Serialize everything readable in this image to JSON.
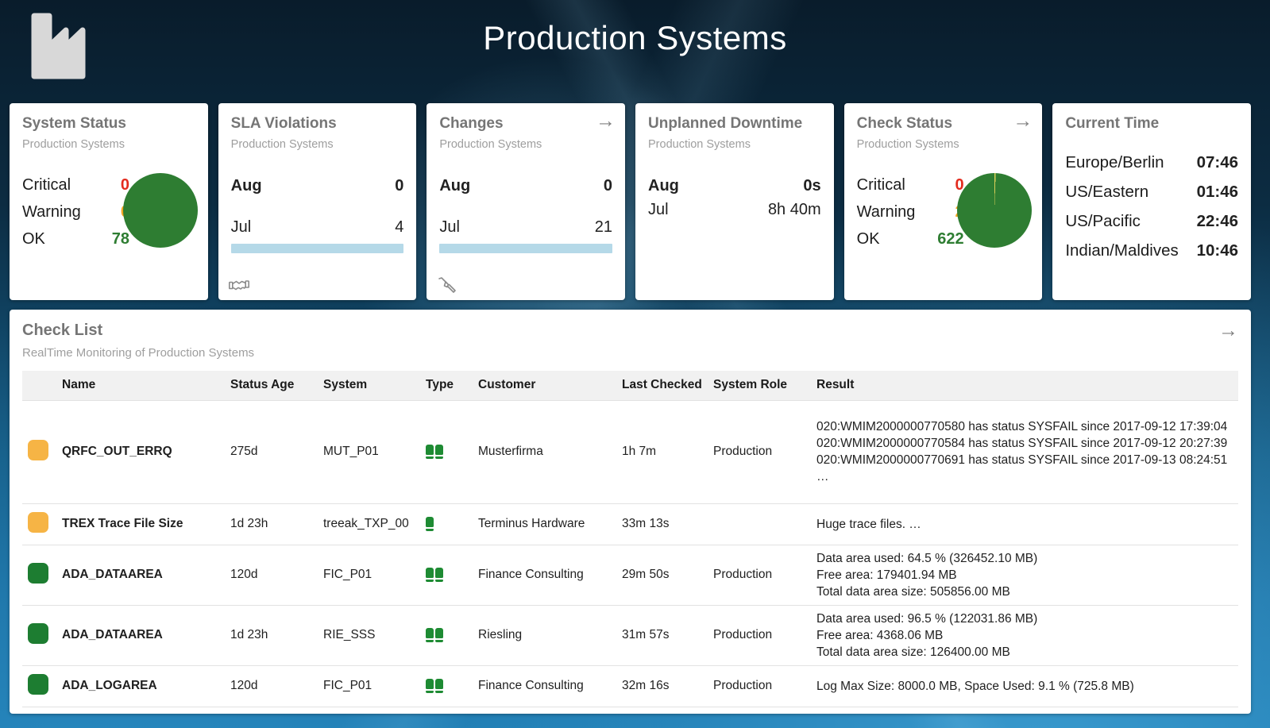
{
  "header": {
    "title": "Production Systems"
  },
  "colors": {
    "critical": "#e32b1e",
    "warning": "#f5a623",
    "ok": "#2e7d32",
    "bar": "#b5d9e8"
  },
  "cards": {
    "system_status": {
      "title": "System Status",
      "subtitle": "Production Systems",
      "rows": [
        {
          "label": "Critical",
          "value": "0"
        },
        {
          "label": "Warning",
          "value": "0"
        },
        {
          "label": "OK",
          "value": "78"
        }
      ]
    },
    "sla_violations": {
      "title": "SLA Violations",
      "subtitle": "Production Systems",
      "rows": [
        {
          "label": "Aug",
          "value": "0"
        },
        {
          "label": "Jul",
          "value": "4"
        }
      ]
    },
    "changes": {
      "title": "Changes",
      "subtitle": "Production Systems",
      "arrow": "→",
      "rows": [
        {
          "label": "Aug",
          "value": "0"
        },
        {
          "label": "Jul",
          "value": "21"
        }
      ]
    },
    "unplanned_downtime": {
      "title": "Unplanned Downtime",
      "subtitle": "Production Systems",
      "rows": [
        {
          "label": "Aug",
          "value": "0s"
        },
        {
          "label": "Jul",
          "value": "8h 40m"
        }
      ]
    },
    "check_status": {
      "title": "Check Status",
      "subtitle": "Production Systems",
      "arrow": "→",
      "rows": [
        {
          "label": "Critical",
          "value": "0"
        },
        {
          "label": "Warning",
          "value": "2"
        },
        {
          "label": "OK",
          "value": "622"
        }
      ]
    },
    "current_time": {
      "title": "Current Time",
      "rows": [
        {
          "label": "Europe/Berlin",
          "value": "07:46"
        },
        {
          "label": "US/Eastern",
          "value": "01:46"
        },
        {
          "label": "US/Pacific",
          "value": "22:46"
        },
        {
          "label": "Indian/Maldives",
          "value": "10:46"
        }
      ]
    }
  },
  "checklist": {
    "title": "Check List",
    "subtitle": "RealTime Monitoring of Production Systems",
    "arrow": "→",
    "columns": {
      "name": "Name",
      "status_age": "Status Age",
      "system": "System",
      "type": "Type",
      "customer": "Customer",
      "last_checked": "Last Checked",
      "system_role": "System Role",
      "result": "Result"
    },
    "rows": [
      {
        "status": "warning",
        "name": "QRFC_OUT_ERRQ",
        "status_age": "275d",
        "system": "MUT_P01",
        "type": "double-db",
        "customer": "Musterfirma",
        "last_checked": "1h 7m",
        "system_role": "Production",
        "result": "020:WMIM2000000770580 has status SYSFAIL since 2017-09-12 17:39:04\n020:WMIM2000000770584 has status SYSFAIL since 2017-09-12 20:27:39\n020:WMIM2000000770691 has status SYSFAIL since 2017-09-13 08:24:51 …"
      },
      {
        "status": "warning",
        "name": "TREX Trace File Size",
        "status_age": "1d 23h",
        "system": "treeak_TXP_00",
        "type": "single-db",
        "customer": "Terminus Hardware",
        "last_checked": "33m 13s",
        "system_role": "",
        "result": "Huge trace files. …"
      },
      {
        "status": "ok",
        "name": "ADA_DATAAREA",
        "status_age": "120d",
        "system": "FIC_P01",
        "type": "double-db",
        "customer": "Finance Consulting",
        "last_checked": "29m 50s",
        "system_role": "Production",
        "result": "Data area used: 64.5 % (326452.10 MB)\nFree area: 179401.94 MB\nTotal data area size: 505856.00 MB"
      },
      {
        "status": "ok",
        "name": "ADA_DATAAREA",
        "status_age": "1d 23h",
        "system": "RIE_SSS",
        "type": "double-db",
        "customer": "Riesling",
        "last_checked": "31m 57s",
        "system_role": "Production",
        "result": "Data area used: 96.5 % (122031.86 MB)\nFree area: 4368.06 MB\nTotal data area size: 126400.00 MB"
      },
      {
        "status": "ok",
        "name": "ADA_LOGAREA",
        "status_age": "120d",
        "system": "FIC_P01",
        "type": "double-db",
        "customer": "Finance Consulting",
        "last_checked": "32m 16s",
        "system_role": "Production",
        "result": "Log Max Size: 8000.0 MB, Space Used: 9.1 % (725.8 MB)"
      }
    ]
  }
}
